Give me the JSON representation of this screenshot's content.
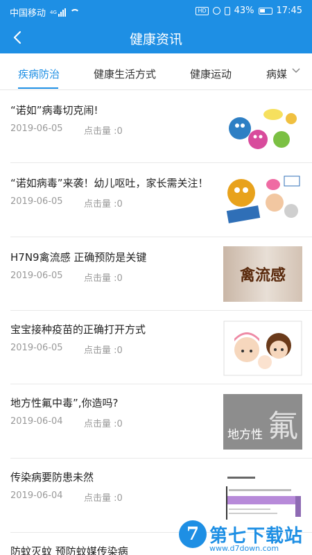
{
  "status_bar": {
    "carrier": "中国移动",
    "network": "4G",
    "hd": "HD",
    "battery": "43%",
    "time": "17:45"
  },
  "header": {
    "title": "健康资讯"
  },
  "tabs": [
    {
      "label": "疾病防治",
      "active": true
    },
    {
      "label": "健康生活方式",
      "active": false
    },
    {
      "label": "健康运动",
      "active": false
    },
    {
      "label": "病媒",
      "active": false
    }
  ],
  "list": {
    "items": [
      {
        "title": "“诺如”病毒切克闹!",
        "date": "2019-06-05",
        "clicks": "点击量 :0"
      },
      {
        "title": "“诺如病毒”来袭！幼儿呕吐，家长需关注！",
        "date": "2019-06-05",
        "clicks": "点击量 :0"
      },
      {
        "title": "H7N9禽流感 正确预防是关键",
        "date": "2019-06-05",
        "clicks": "点击量 :0",
        "thumb_text": "禽流感"
      },
      {
        "title": "宝宝接种疫苗的正确打开方式",
        "date": "2019-06-05",
        "clicks": "点击量 :0"
      },
      {
        "title": "地方性氟中毒”,你造吗?",
        "date": "2019-06-04",
        "clicks": "点击量 :0",
        "thumb_text": "地方性",
        "thumb_char": "氟"
      },
      {
        "title": "传染病要防患未然",
        "date": "2019-06-04",
        "clicks": "点击量 :0"
      },
      {
        "title": "防蚊灭蚊 预防蚊媒传染病",
        "date": "",
        "clicks": ""
      }
    ]
  },
  "watermark": {
    "logo": "7",
    "name": "第七下载站",
    "url": "www.d7down.com"
  },
  "colors": {
    "primary": "#1e8fe4",
    "text": "#222222",
    "meta": "#999999"
  }
}
